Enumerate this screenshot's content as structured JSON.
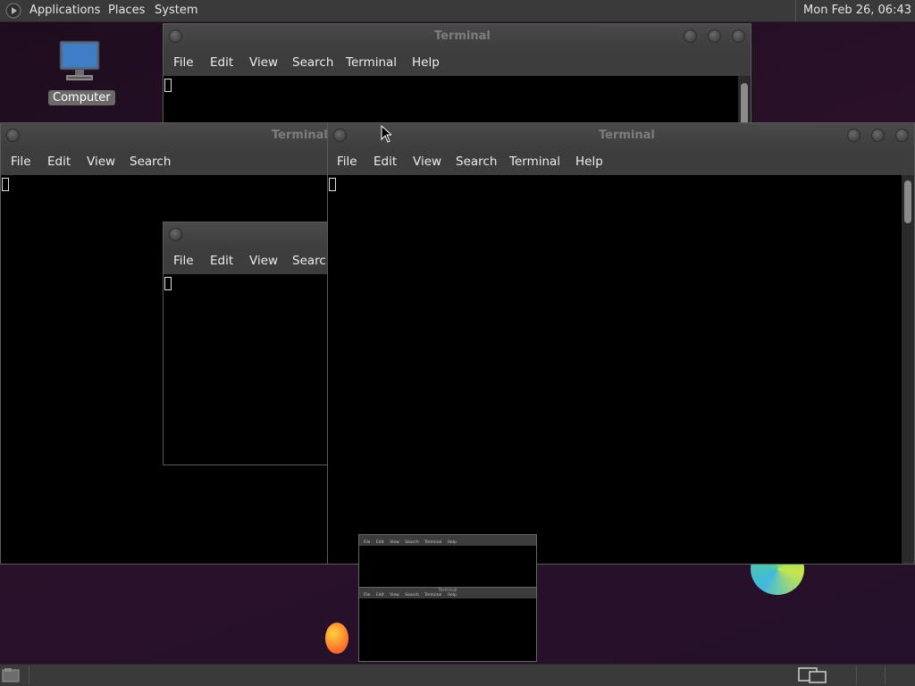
{
  "top_panel": {
    "menus": [
      "Applications",
      "Places",
      "System"
    ],
    "clock": "Mon Feb 26, 06:43"
  },
  "desktop": {
    "icons": [
      {
        "label": "Computer",
        "icon": "computer-icon"
      }
    ]
  },
  "windows": {
    "back_terminal": {
      "title": "Terminal",
      "menu": [
        "File",
        "Edit",
        "View",
        "Search",
        "Terminal",
        "Help"
      ]
    },
    "left_terminal": {
      "title": "Terminal",
      "menu": [
        "File",
        "Edit",
        "View",
        "Search"
      ]
    },
    "middle_terminal": {
      "title": "",
      "menu": [
        "File",
        "Edit",
        "View",
        "Search"
      ]
    },
    "main_terminal": {
      "title": "Terminal",
      "menu": [
        "File",
        "Edit",
        "View",
        "Search",
        "Terminal",
        "Help"
      ]
    }
  },
  "thumbnails": [
    {
      "title": "",
      "menu": [
        "File",
        "Edit",
        "View",
        "Search",
        "Terminal",
        "Help"
      ]
    },
    {
      "title": "Terminal",
      "menu": [
        "File",
        "Edit",
        "View",
        "Search",
        "Terminal",
        "Help"
      ]
    }
  ],
  "colors": {
    "panel": "#3a3a3a",
    "window_chrome": "#3b3b3b",
    "terminal_bg": "#000000",
    "desktop_bg": "#24102a"
  }
}
